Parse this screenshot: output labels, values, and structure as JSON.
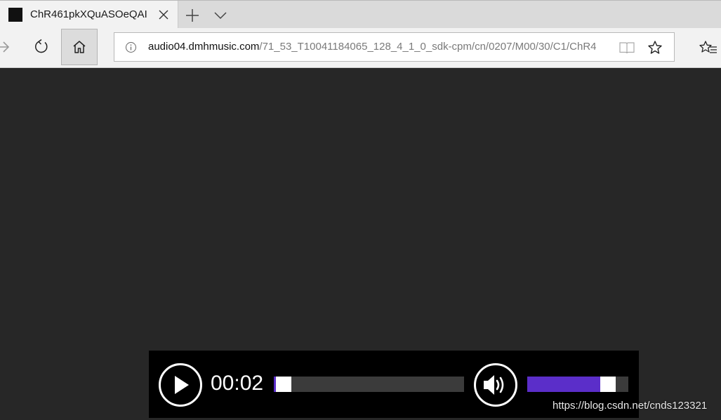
{
  "browser": {
    "tab": {
      "title": "ChR461pkXQuASOeQAI",
      "favicon": "black-square-favicon"
    },
    "new_tab_icon": "plus-icon",
    "tab_list_icon": "chevron-down-icon",
    "nav": {
      "forward_icon": "forward-arrow-icon",
      "refresh_icon": "refresh-icon",
      "home_icon": "home-icon"
    },
    "address": {
      "info_icon": "info-icon",
      "domain": "audio04.dmhmusic.com",
      "path": "/71_53_T10041184065_128_4_1_0_sdk-cpm/cn/0207/M00/30/C1/ChR4",
      "reading_view_icon": "reading-view-icon",
      "favorite_icon": "star-icon"
    },
    "favorites_hub_icon": "favorites-hub-icon"
  },
  "player": {
    "time": "00:02",
    "play_icon": "play-icon",
    "volume_icon": "speaker-icon",
    "progress": 0.01,
    "volume": 0.85,
    "accent": "#5b2ec9"
  },
  "watermark": "https://blog.csdn.net/cnds123321"
}
